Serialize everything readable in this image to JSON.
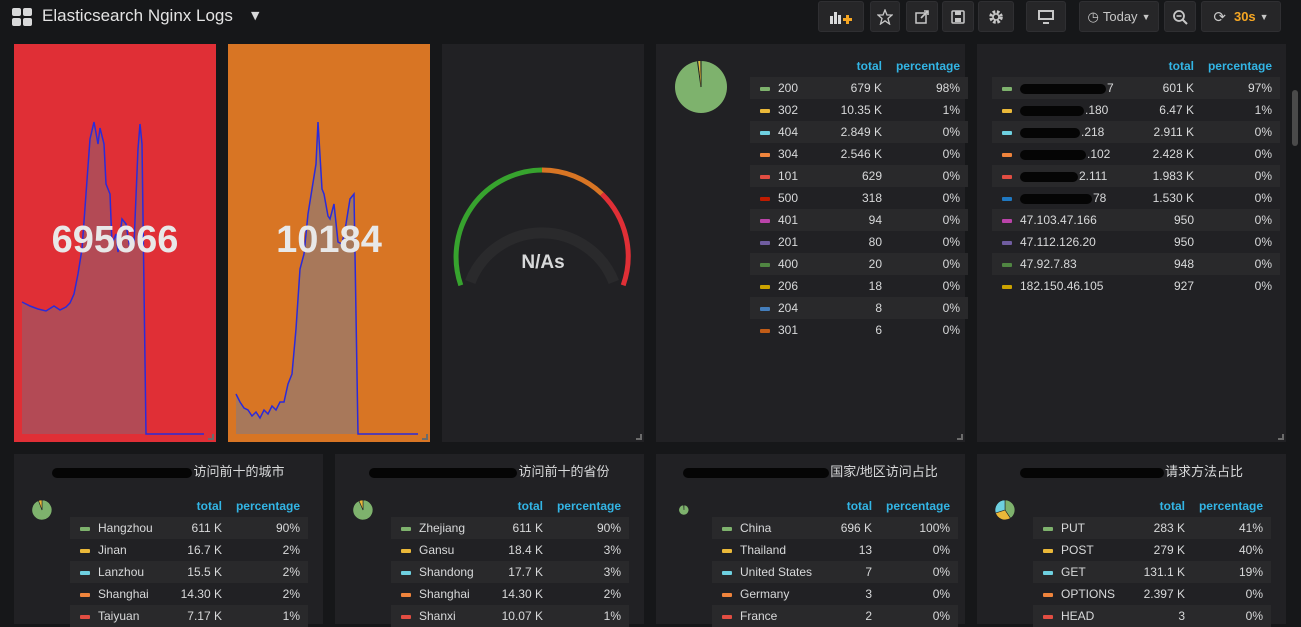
{
  "header": {
    "title": "Elasticsearch Nginx Logs",
    "time_range": "Today",
    "refresh": "30s"
  },
  "colors": {
    "red": "#e02f36",
    "orange": "#d87524",
    "green": "#37a32e",
    "line": "#2b2bd9",
    "accent": "#33b5e5"
  },
  "stats": [
    {
      "value": "695666",
      "color": "#e02f36",
      "fill": "#b34a55"
    },
    {
      "value": "10184",
      "color": "#d87524",
      "fill": "#a8785a"
    }
  ],
  "gauge": {
    "value": "N/As"
  },
  "legend_headers": {
    "total": "total",
    "percentage": "percentage"
  },
  "status_panel": {
    "rows": [
      {
        "name": "200",
        "total": "679 K",
        "pct": "98%",
        "color": "#7eb26d"
      },
      {
        "name": "302",
        "total": "10.35 K",
        "pct": "1%",
        "color": "#eab839"
      },
      {
        "name": "404",
        "total": "2.849 K",
        "pct": "0%",
        "color": "#6ed0e0"
      },
      {
        "name": "304",
        "total": "2.546 K",
        "pct": "0%",
        "color": "#ef843c"
      },
      {
        "name": "101",
        "total": "629",
        "pct": "0%",
        "color": "#e24d42"
      },
      {
        "name": "500",
        "total": "318",
        "pct": "0%",
        "color": "#bf1b00"
      },
      {
        "name": "401",
        "total": "94",
        "pct": "0%",
        "color": "#ba43a9"
      },
      {
        "name": "201",
        "total": "80",
        "pct": "0%",
        "color": "#705da0"
      },
      {
        "name": "400",
        "total": "20",
        "pct": "0%",
        "color": "#508642"
      },
      {
        "name": "206",
        "total": "18",
        "pct": "0%",
        "color": "#cca300"
      },
      {
        "name": "204",
        "total": "8",
        "pct": "0%",
        "color": "#447ebc"
      },
      {
        "name": "301",
        "total": "6",
        "pct": "0%",
        "color": "#c15c17"
      }
    ]
  },
  "ip_panel": {
    "rows": [
      {
        "name": "7",
        "blur": 86,
        "total": "601 K",
        "pct": "97%",
        "color": "#7eb26d"
      },
      {
        "name": ".180",
        "blur": 64,
        "total": "6.47 K",
        "pct": "1%",
        "color": "#eab839"
      },
      {
        "name": ".218",
        "blur": 60,
        "total": "2.911 K",
        "pct": "0%",
        "color": "#6ed0e0"
      },
      {
        "name": ".102",
        "blur": 66,
        "total": "2.428 K",
        "pct": "0%",
        "color": "#ef843c"
      },
      {
        "name": "2.111",
        "blur": 58,
        "total": "1.983 K",
        "pct": "0%",
        "color": "#e24d42"
      },
      {
        "name": "78",
        "blur": 72,
        "total": "1.530 K",
        "pct": "0%",
        "color": "#1f78c1"
      },
      {
        "name": "47.103.47.166",
        "blur": 0,
        "total": "950",
        "pct": "0%",
        "color": "#ba43a9"
      },
      {
        "name": "47.112.126.20",
        "blur": 0,
        "total": "950",
        "pct": "0%",
        "color": "#705da0"
      },
      {
        "name": "47.92.7.83",
        "blur": 0,
        "total": "948",
        "pct": "0%",
        "color": "#508642"
      },
      {
        "name": "182.150.46.105",
        "blur": 0,
        "total": "927",
        "pct": "0%",
        "color": "#cca300"
      }
    ]
  },
  "bottom_panels": [
    {
      "title": "访问前十的城市",
      "blur": 140,
      "rows": [
        {
          "name": "Hangzhou",
          "total": "611 K",
          "pct": "90%",
          "color": "#7eb26d"
        },
        {
          "name": "Jinan",
          "total": "16.7 K",
          "pct": "2%",
          "color": "#eab839"
        },
        {
          "name": "Lanzhou",
          "total": "15.5 K",
          "pct": "2%",
          "color": "#6ed0e0"
        },
        {
          "name": "Shanghai",
          "total": "14.30 K",
          "pct": "2%",
          "color": "#ef843c"
        },
        {
          "name": "Taiyuan",
          "total": "7.17 K",
          "pct": "1%",
          "color": "#e24d42"
        }
      ]
    },
    {
      "title": "访问前十的省份",
      "blur": 148,
      "rows": [
        {
          "name": "Zhejiang",
          "total": "611 K",
          "pct": "90%",
          "color": "#7eb26d"
        },
        {
          "name": "Gansu",
          "total": "18.4 K",
          "pct": "3%",
          "color": "#eab839"
        },
        {
          "name": "Shandong",
          "total": "17.7 K",
          "pct": "3%",
          "color": "#6ed0e0"
        },
        {
          "name": "Shanghai",
          "total": "14.30 K",
          "pct": "2%",
          "color": "#ef843c"
        },
        {
          "name": "Shanxi",
          "total": "10.07 K",
          "pct": "1%",
          "color": "#e24d42"
        }
      ]
    },
    {
      "title": "国家/地区访问占比",
      "blur": 146,
      "rows": [
        {
          "name": "China",
          "total": "696 K",
          "pct": "100%",
          "color": "#7eb26d"
        },
        {
          "name": "Thailand",
          "total": "13",
          "pct": "0%",
          "color": "#eab839"
        },
        {
          "name": "United States",
          "total": "7",
          "pct": "0%",
          "color": "#6ed0e0"
        },
        {
          "name": "Germany",
          "total": "3",
          "pct": "0%",
          "color": "#ef843c"
        },
        {
          "name": "France",
          "total": "2",
          "pct": "0%",
          "color": "#e24d42"
        }
      ]
    },
    {
      "title": "请求方法占比",
      "blur": 144,
      "rows": [
        {
          "name": "PUT",
          "total": "283 K",
          "pct": "41%",
          "color": "#7eb26d"
        },
        {
          "name": "POST",
          "total": "279 K",
          "pct": "40%",
          "color": "#eab839"
        },
        {
          "name": "GET",
          "total": "131.1 K",
          "pct": "19%",
          "color": "#6ed0e0"
        },
        {
          "name": "OPTIONS",
          "total": "2.397 K",
          "pct": "0%",
          "color": "#ef843c"
        },
        {
          "name": "HEAD",
          "total": "3",
          "pct": "0%",
          "color": "#e24d42"
        }
      ]
    }
  ]
}
